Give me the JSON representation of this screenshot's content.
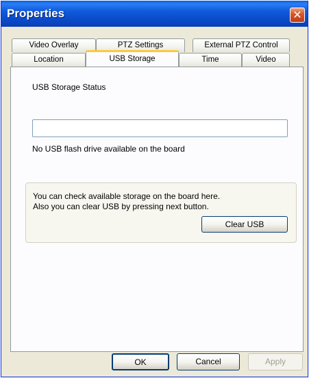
{
  "window": {
    "title": "Properties",
    "close_glyph": "✕"
  },
  "tabs": {
    "row_back": [
      "Video Overlay",
      "PTZ Settings",
      "External PTZ Control"
    ],
    "row_front": [
      "Location",
      "USB Storage",
      "Time",
      "Video"
    ],
    "active": "USB Storage"
  },
  "usb_panel": {
    "status_heading": "USB Storage Status",
    "status_value": "",
    "status_message": "No USB flash drive available on the board",
    "info_line1": "You can check available storage on the board here.",
    "info_line2": "Also you can clear USB by pressing next button.",
    "clear_button": "Clear USB"
  },
  "footer": {
    "ok": "OK",
    "cancel": "Cancel",
    "apply": "Apply"
  }
}
